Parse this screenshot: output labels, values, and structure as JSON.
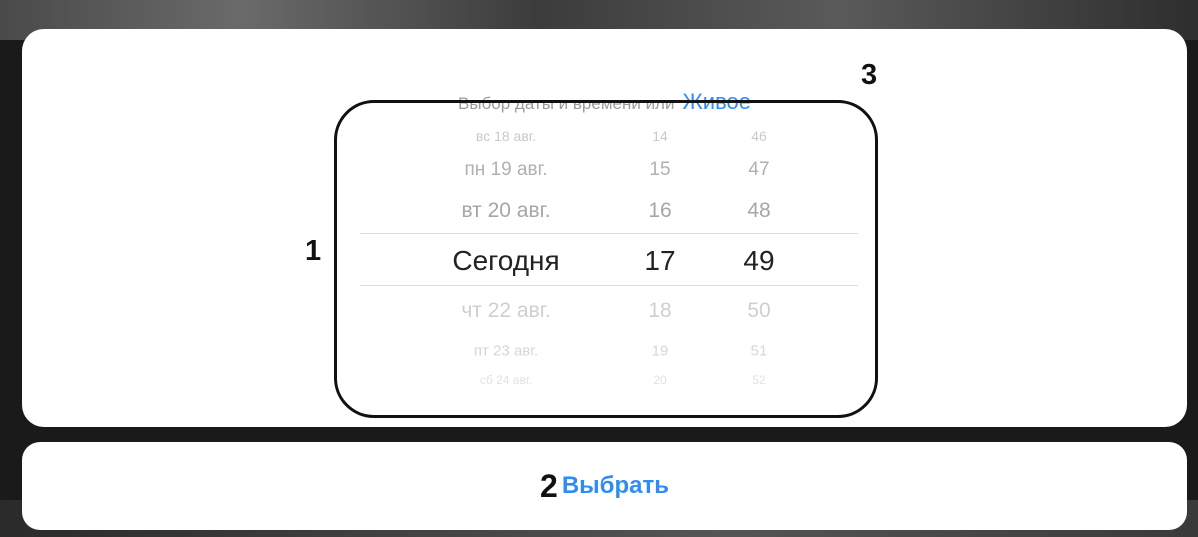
{
  "header": {
    "title": "Выбор даты и времени или",
    "live_label": "Живое",
    "callout": "3"
  },
  "picker": {
    "callout": "1",
    "rows": [
      {
        "date": "вс 18 авг.",
        "hour": "14",
        "minute": "46"
      },
      {
        "date": "пн 19 авг.",
        "hour": "15",
        "minute": "47"
      },
      {
        "date": "вт 20 авг.",
        "hour": "16",
        "minute": "48"
      },
      {
        "date": "Сегодня",
        "hour": "17",
        "minute": "49"
      },
      {
        "date": "чт 22 авг.",
        "hour": "18",
        "minute": "50"
      },
      {
        "date": "пт 23 авг.",
        "hour": "19",
        "minute": "51"
      },
      {
        "date": "сб 24 авг.",
        "hour": "20",
        "minute": "52"
      }
    ],
    "selected_index": 3
  },
  "footer": {
    "callout": "2",
    "select_label": "Выбрать"
  },
  "colors": {
    "accent": "#2f8cf7",
    "sheet": "#ffffff"
  }
}
